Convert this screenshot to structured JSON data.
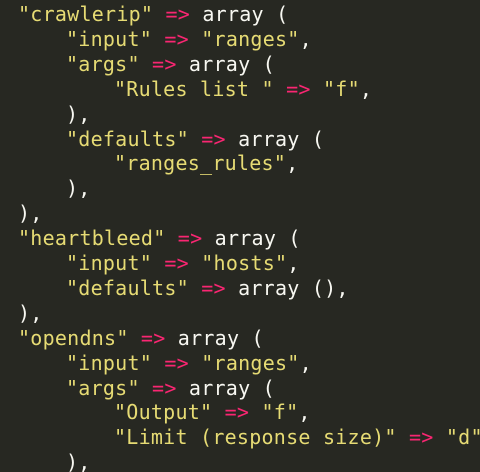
{
  "colors": {
    "background": "#272822",
    "string": "#e6db74",
    "operator": "#f92672",
    "text": "#f8f8f2"
  },
  "code": {
    "lines": [
      {
        "tokens": [
          {
            "t": "str",
            "v": "\"crawlerip\""
          },
          {
            "t": "plain",
            "v": " "
          },
          {
            "t": "op",
            "v": "=>"
          },
          {
            "t": "plain",
            "v": " array ("
          }
        ]
      },
      {
        "tokens": [
          {
            "t": "str",
            "v": "\"input\""
          },
          {
            "t": "plain",
            "v": " "
          },
          {
            "t": "op",
            "v": "=>"
          },
          {
            "t": "plain",
            "v": " "
          },
          {
            "t": "str",
            "v": "\"ranges\""
          },
          {
            "t": "plain",
            "v": ","
          }
        ]
      },
      {
        "tokens": [
          {
            "t": "str",
            "v": "\"args\""
          },
          {
            "t": "plain",
            "v": " "
          },
          {
            "t": "op",
            "v": "=>"
          },
          {
            "t": "plain",
            "v": " array ("
          }
        ]
      },
      {
        "tokens": [
          {
            "t": "str",
            "v": "\"Rules list \""
          },
          {
            "t": "plain",
            "v": " "
          },
          {
            "t": "op",
            "v": "=>"
          },
          {
            "t": "plain",
            "v": " "
          },
          {
            "t": "str",
            "v": "\"f\""
          },
          {
            "t": "plain",
            "v": ","
          }
        ]
      },
      {
        "tokens": [
          {
            "t": "plain",
            "v": "),"
          }
        ]
      },
      {
        "tokens": [
          {
            "t": "str",
            "v": "\"defaults\""
          },
          {
            "t": "plain",
            "v": " "
          },
          {
            "t": "op",
            "v": "=>"
          },
          {
            "t": "plain",
            "v": " array ("
          }
        ]
      },
      {
        "tokens": [
          {
            "t": "str",
            "v": "\"ranges_rules\""
          },
          {
            "t": "plain",
            "v": ","
          }
        ]
      },
      {
        "tokens": [
          {
            "t": "plain",
            "v": "),"
          }
        ]
      },
      {
        "tokens": [
          {
            "t": "plain",
            "v": "),"
          }
        ]
      },
      {
        "tokens": [
          {
            "t": "str",
            "v": "\"heartbleed\""
          },
          {
            "t": "plain",
            "v": " "
          },
          {
            "t": "op",
            "v": "=>"
          },
          {
            "t": "plain",
            "v": " array ("
          }
        ]
      },
      {
        "tokens": [
          {
            "t": "str",
            "v": "\"input\""
          },
          {
            "t": "plain",
            "v": " "
          },
          {
            "t": "op",
            "v": "=>"
          },
          {
            "t": "plain",
            "v": " "
          },
          {
            "t": "str",
            "v": "\"hosts\""
          },
          {
            "t": "plain",
            "v": ","
          }
        ]
      },
      {
        "tokens": [
          {
            "t": "str",
            "v": "\"defaults\""
          },
          {
            "t": "plain",
            "v": " "
          },
          {
            "t": "op",
            "v": "=>"
          },
          {
            "t": "plain",
            "v": " array (),"
          }
        ]
      },
      {
        "tokens": [
          {
            "t": "plain",
            "v": "),"
          }
        ]
      },
      {
        "tokens": [
          {
            "t": "str",
            "v": "\"opendns\""
          },
          {
            "t": "plain",
            "v": " "
          },
          {
            "t": "op",
            "v": "=>"
          },
          {
            "t": "plain",
            "v": " array ("
          }
        ]
      },
      {
        "tokens": [
          {
            "t": "str",
            "v": "\"input\""
          },
          {
            "t": "plain",
            "v": " "
          },
          {
            "t": "op",
            "v": "=>"
          },
          {
            "t": "plain",
            "v": " "
          },
          {
            "t": "str",
            "v": "\"ranges\""
          },
          {
            "t": "plain",
            "v": ","
          }
        ]
      },
      {
        "tokens": [
          {
            "t": "str",
            "v": "\"args\""
          },
          {
            "t": "plain",
            "v": " "
          },
          {
            "t": "op",
            "v": "=>"
          },
          {
            "t": "plain",
            "v": " array ("
          }
        ]
      },
      {
        "tokens": [
          {
            "t": "str",
            "v": "\"Output\""
          },
          {
            "t": "plain",
            "v": " "
          },
          {
            "t": "op",
            "v": "=>"
          },
          {
            "t": "plain",
            "v": " "
          },
          {
            "t": "str",
            "v": "\"f\""
          },
          {
            "t": "plain",
            "v": ","
          }
        ]
      },
      {
        "tokens": [
          {
            "t": "str",
            "v": "\"Limit (response size)\""
          },
          {
            "t": "plain",
            "v": " "
          },
          {
            "t": "op",
            "v": "=>"
          },
          {
            "t": "plain",
            "v": " "
          },
          {
            "t": "str",
            "v": "\"d\""
          },
          {
            "t": "plain",
            "v": ","
          }
        ]
      },
      {
        "tokens": [
          {
            "t": "plain",
            "v": "),"
          }
        ]
      }
    ]
  }
}
